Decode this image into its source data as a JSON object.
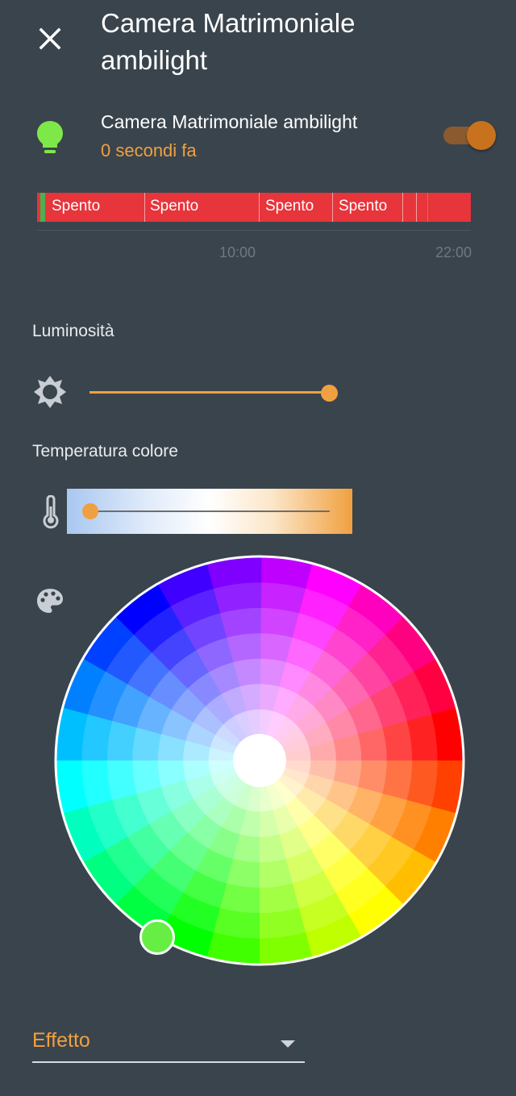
{
  "dialog": {
    "title": "Camera Matrimoniale ambilight",
    "close_icon": "close-icon"
  },
  "entity": {
    "name": "Camera Matrimoniale ambilight",
    "last_changed": "0 secondi fa",
    "icon": "lightbulb-icon",
    "icon_color": "#7ee84a",
    "toggle_on": true,
    "accent_color": "#f0a040"
  },
  "history": {
    "bar_color": "#e8343b",
    "segments": [
      "Spento",
      "Spento",
      "Spento",
      "Spento"
    ],
    "ticks": [
      "10:00",
      "22:00"
    ]
  },
  "brightness": {
    "label": "Luminosità",
    "icon": "brightness-icon",
    "value_percent": 100
  },
  "color_temp": {
    "label": "Temperatura colore",
    "icon": "thermometer-icon",
    "value_percent": 8
  },
  "color_wheel": {
    "icon": "palette-icon",
    "selected_color": "#66ee44"
  },
  "effect": {
    "label": "Effetto",
    "icon": "dropdown-arrow-icon"
  }
}
